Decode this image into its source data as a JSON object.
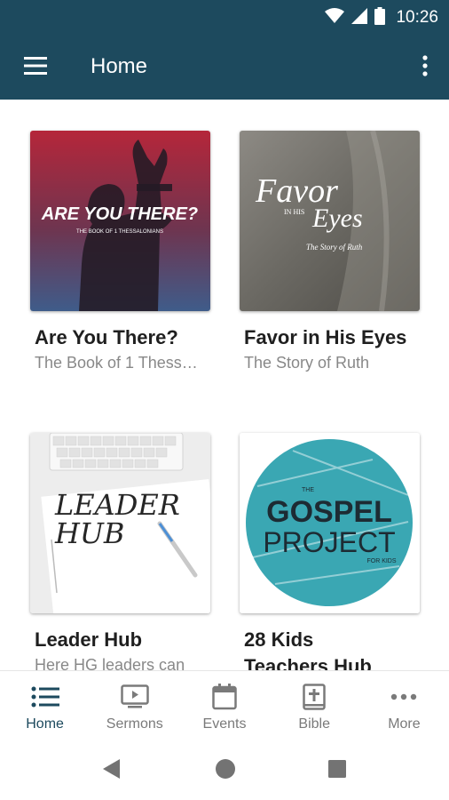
{
  "status_bar": {
    "time": "10:26"
  },
  "app_bar": {
    "title": "Home"
  },
  "cards": [
    {
      "title": "Are You There?",
      "subtitle": "The Book of 1 Thess…",
      "art_heading": "ARE YOU THERE?",
      "art_caption": "THE BOOK OF 1 THESSALONIANS"
    },
    {
      "title": "Favor in His Eyes",
      "subtitle": "The Story of Ruth",
      "art_heading_1": "Favor",
      "art_heading_2": "IN HIS",
      "art_heading_3": "Eyes",
      "art_caption": "The Story of Ruth"
    },
    {
      "title": "Leader Hub",
      "subtitle": "Here HG leaders can",
      "art_line_1": "LEADER",
      "art_line_2": "HUB"
    },
    {
      "title_line_1": "28 Kids",
      "title_line_2": "Teachers Hub",
      "art_small": "THE",
      "art_line_1": "GOSPEL",
      "art_line_2": "PROJECT",
      "art_tag": "FOR KIDS"
    }
  ],
  "bottom_nav": [
    {
      "label": "Home",
      "icon": "list-icon",
      "active": true
    },
    {
      "label": "Sermons",
      "icon": "tv-play-icon"
    },
    {
      "label": "Events",
      "icon": "calendar-icon"
    },
    {
      "label": "Bible",
      "icon": "bible-icon"
    },
    {
      "label": "More",
      "icon": "more-horizontal-icon"
    }
  ],
  "colors": {
    "primary": "#1d4a5e",
    "card1_top": "#b5263a",
    "card1_bottom": "#3f5c8a",
    "gospel_teal": "#3aa7b3"
  }
}
